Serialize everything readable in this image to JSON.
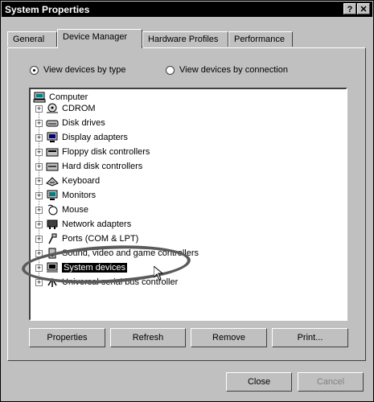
{
  "window": {
    "title": "System Properties",
    "help_btn": "?",
    "close_btn": "✕"
  },
  "tabs": [
    {
      "label": "General",
      "active": false
    },
    {
      "label": "Device Manager",
      "active": true
    },
    {
      "label": "Hardware Profiles",
      "active": false
    },
    {
      "label": "Performance",
      "active": false
    }
  ],
  "view_options": {
    "by_type": {
      "label": "View devices by type",
      "selected": true
    },
    "by_connection": {
      "label": "View devices by connection",
      "selected": false
    }
  },
  "tree": {
    "root": {
      "label": "Computer",
      "icon": "computer-icon"
    },
    "items": [
      {
        "label": "CDROM",
        "icon": "cdrom-icon"
      },
      {
        "label": "Disk drives",
        "icon": "disk-drive-icon"
      },
      {
        "label": "Display adapters",
        "icon": "display-adapter-icon"
      },
      {
        "label": "Floppy disk controllers",
        "icon": "floppy-controller-icon"
      },
      {
        "label": "Hard disk controllers",
        "icon": "hard-disk-controller-icon"
      },
      {
        "label": "Keyboard",
        "icon": "keyboard-icon"
      },
      {
        "label": "Monitors",
        "icon": "monitor-icon"
      },
      {
        "label": "Mouse",
        "icon": "mouse-icon"
      },
      {
        "label": "Network adapters",
        "icon": "network-adapter-icon"
      },
      {
        "label": "Ports (COM & LPT)",
        "icon": "port-icon"
      },
      {
        "label": "Sound, video and game controllers",
        "icon": "sound-icon"
      },
      {
        "label": "System devices",
        "icon": "system-device-icon",
        "selected": true
      },
      {
        "label": "Universal serial bus controller",
        "icon": "usb-icon"
      }
    ]
  },
  "buttons": {
    "properties": "Properties",
    "refresh": "Refresh",
    "remove": "Remove",
    "print": "Print...",
    "close": "Close",
    "cancel": "Cancel"
  }
}
